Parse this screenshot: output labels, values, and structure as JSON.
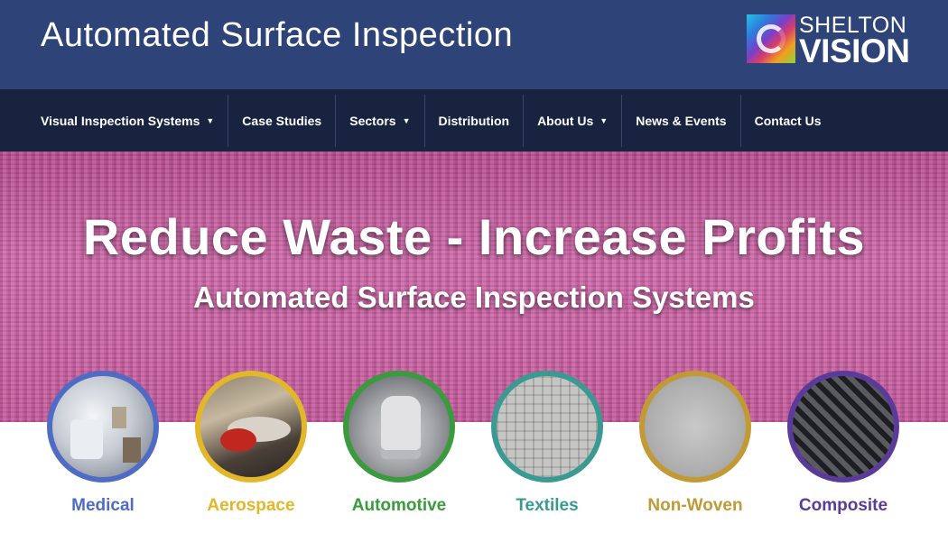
{
  "header": {
    "site_title": "Automated Surface Inspection",
    "logo": {
      "line1": "SHELTON",
      "line2": "VISION"
    }
  },
  "nav": {
    "items": [
      {
        "label": "Visual Inspection Systems",
        "dropdown": true
      },
      {
        "label": "Case Studies",
        "dropdown": false
      },
      {
        "label": "Sectors",
        "dropdown": true
      },
      {
        "label": "Distribution",
        "dropdown": false
      },
      {
        "label": "About Us",
        "dropdown": true
      },
      {
        "label": "News & Events",
        "dropdown": false
      },
      {
        "label": "Contact Us",
        "dropdown": false
      }
    ],
    "caret": "▼"
  },
  "hero": {
    "title": "Reduce Waste - Increase Profits",
    "subtitle": "Automated Surface Inspection Systems"
  },
  "sectors": [
    {
      "label": "Medical",
      "color": "#4f6bc4"
    },
    {
      "label": "Aerospace",
      "color": "#e2b729"
    },
    {
      "label": "Automotive",
      "color": "#3a9a3e"
    },
    {
      "label": "Textiles",
      "color": "#3a9a92"
    },
    {
      "label": "Non-Woven",
      "color": "#c19a35"
    },
    {
      "label": "Composite",
      "color": "#5a3b9a"
    }
  ],
  "colors": {
    "header_bg": "#2e4479",
    "nav_bg": "#182340",
    "hero_bg": "#c9599f"
  }
}
